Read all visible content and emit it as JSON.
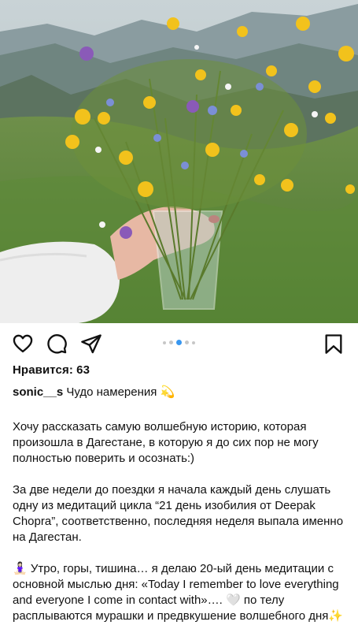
{
  "post": {
    "photo_icon": "wildflower-bouquet-photo",
    "carousel": {
      "count": 5,
      "active_index": 2
    },
    "likes_text": "Нравится: 63",
    "username": "sonic__s",
    "caption_title": " Чудо намерения 💫",
    "paragraphs": [
      "Хочу рассказать самую волшебную историю, которая произошла в Дагестане, в которую я до сих пор не могу полностью поверить и осознать:)",
      "За две недели до поездки я начала каждый день слушать одну из медитаций цикла “21 день изобилия от Deepak Chopra”, соответственно, последняя неделя выпала именно на Дагестан.",
      "🧘🏻‍♀️ Утро, горы, тишина… я делаю 20-ый день медитации с основной мыслью дня: «Today I remember to love everything and everyone I come in contact with»…. 🤍 по телу расплываются мурашки и предвкушение волшебного дня✨"
    ]
  },
  "icons": {
    "like": "heart-icon",
    "comment": "comment-icon",
    "share": "send-icon",
    "save": "bookmark-icon"
  },
  "colors": {
    "accent": "#3897f0",
    "dot_inactive": "#c7c7c7",
    "text": "#111111"
  }
}
